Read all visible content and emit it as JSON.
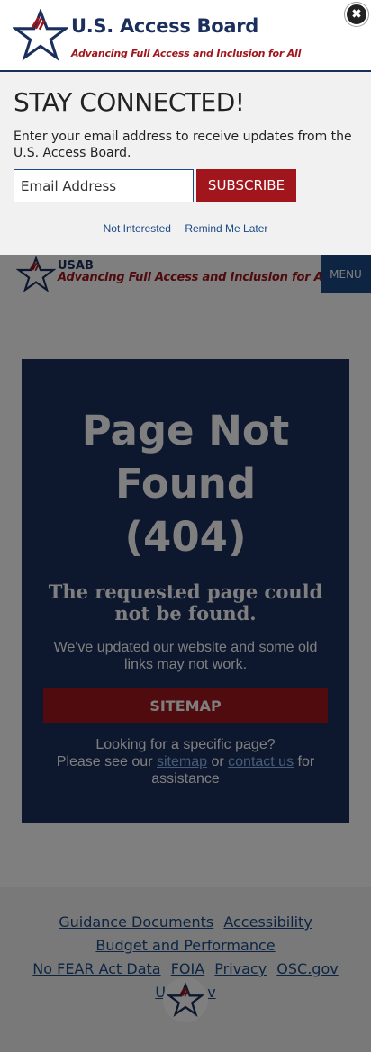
{
  "popup": {
    "brand": "U.S. Access Board",
    "tagline": "Advancing Full Access and Inclusion for All",
    "close_icon": "✖",
    "heading": "STAY CONNECTED!",
    "description": "Enter your email address to receive updates from the U.S. Access Board.",
    "email_placeholder": "Email Address",
    "subscribe_label": "SUBSCRIBE",
    "not_interested_label": "Not Interested",
    "remind_later_label": "Remind Me Later"
  },
  "header": {
    "abbr": "USAB",
    "tagline": "Advancing Full Access and Inclusion for All",
    "menu_label": "MENU"
  },
  "main": {
    "title_line1": "Page Not",
    "title_line2": "Found",
    "title_line3": "(404)",
    "subtitle": "The requested page could not be found.",
    "note": "We've updated our website and some old links may not work.",
    "sitemap_button": "SITEMAP",
    "help_line1": "Looking for a specific page?",
    "help_prefix": "Please see our",
    "help_link_sitemap": "sitemap",
    "help_or": "or",
    "help_link_contact": "contact us",
    "help_suffix": "for",
    "help_line3": "assistance"
  },
  "footer": {
    "links": [
      "Guidance Documents",
      "Accessibility",
      "Budget and Performance",
      "No FEAR Act Data",
      "FOIA",
      "Privacy",
      "OSC.gov",
      "USA.gov"
    ]
  },
  "colors": {
    "navy": "#1b2f5d",
    "brand_red": "#a0161c",
    "link_blue": "#1b4a86",
    "overlay": "rgba(0,0,0,0.5)"
  }
}
